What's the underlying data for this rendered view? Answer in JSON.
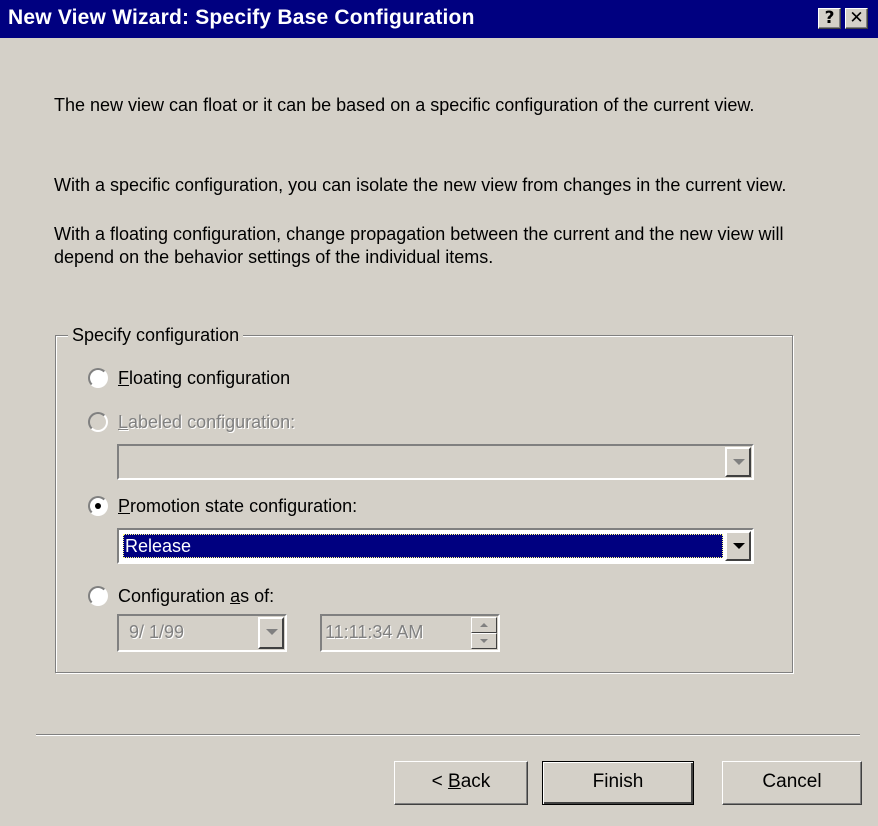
{
  "window": {
    "title": "New View Wizard: Specify Base Configuration",
    "help_glyph": "?",
    "close_glyph": "✕"
  },
  "description": {
    "paragraph1": "The new view can float or it can be based on a specific configuration of the current view.",
    "paragraph2": "With a specific configuration, you can isolate the new view from changes in the current view.",
    "paragraph3": "With a floating configuration, change propagation between the current and the new view will depend on the behavior settings of the individual items."
  },
  "group": {
    "legend": "Specify configuration",
    "options": [
      {
        "mnemonic": "F",
        "rest": "loating configuration",
        "selected": false,
        "enabled": true
      },
      {
        "mnemonic": "L",
        "rest": "abeled configuration:",
        "selected": false,
        "enabled": false
      },
      {
        "mnemonic": "P",
        "rest": "romotion state configuration:",
        "selected": true,
        "enabled": true
      },
      {
        "before": "Configuration ",
        "mnemonic": "a",
        "rest": "s of:",
        "selected": false,
        "enabled": true
      }
    ],
    "labeled_combo_value": "",
    "promotion_combo_value": "Release",
    "date_value": "9/ 1/99",
    "time_value": "11:11:34 AM"
  },
  "buttons": {
    "back_prefix": "< ",
    "back_mnemonic": "B",
    "back_rest": "ack",
    "finish": "Finish",
    "cancel": "Cancel"
  },
  "colors": {
    "titlebar": "#000080",
    "dialog_face": "#d4d0c8",
    "selection": "#000080"
  }
}
